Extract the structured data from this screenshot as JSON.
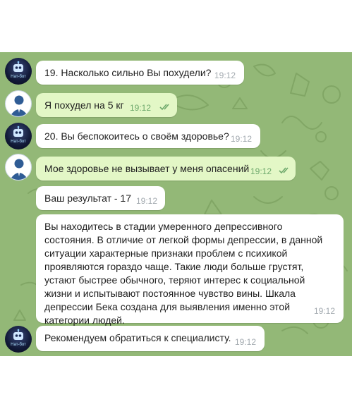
{
  "chat": {
    "bot_avatar_label": "Нат-бот",
    "messages": [
      {
        "sender": "bot",
        "text": "19. Насколько сильно Вы похудели?",
        "time": "19:12"
      },
      {
        "sender": "user",
        "text": "Я похудел на 5 кг",
        "time": "19:12",
        "status": "read"
      },
      {
        "sender": "bot",
        "text": "20. Вы беспокоитесь о своём здоровье?",
        "time": "19:12"
      },
      {
        "sender": "user",
        "text": "Мое здоровье не вызывает у меня опасений",
        "time": "19:12",
        "status": "read"
      },
      {
        "sender": "bot",
        "text": "Ваш результат - 17",
        "time": "19:12"
      },
      {
        "sender": "bot",
        "text": "Вы находитесь в стадии умеренного депрессивного состояния. В отличие от легкой формы депрессии, в данной ситуации характерные признаки проблем с психикой проявляются гораздо чаще. Такие люди больше грустят, устают быстрее обычного, теряют интерес к социальной жизни и испытывают постоянное чувство вины. Шкала депрессии Бека создана для выявления именно этой категории людей.",
        "time": "19:12"
      },
      {
        "sender": "bot",
        "text": "Рекомендуем обратиться к специалисту.",
        "time": "19:12"
      }
    ]
  },
  "colors": {
    "chat_background": "#93b877",
    "incoming_bubble": "#ffffff",
    "outgoing_bubble": "#e3f7c6",
    "read_checks": "#6ea96c"
  }
}
